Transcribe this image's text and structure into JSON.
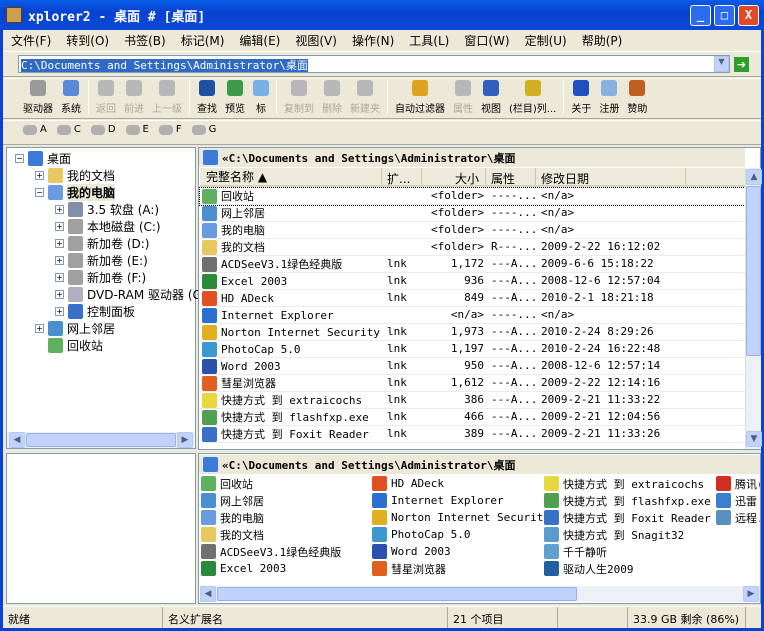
{
  "window": {
    "title": "xplorer2 - 桌面 # [桌面]",
    "min": "_",
    "max": "□",
    "close": "X"
  },
  "menu": [
    "文件(F)",
    "转到(O)",
    "书签(B)",
    "标记(M)",
    "编辑(E)",
    "视图(V)",
    "操作(N)",
    "工具(L)",
    "窗口(W)",
    "定制(U)",
    "帮助(P)"
  ],
  "address": {
    "value": "C:\\Documents and Settings\\Administrator\\桌面",
    "go": "➔"
  },
  "toolbar": [
    {
      "label": "驱动器",
      "icon": "drive-icon",
      "color": "#9a9a9a",
      "enabled": true
    },
    {
      "label": "系统",
      "icon": "computer-icon",
      "color": "#5a8ad8",
      "enabled": true
    },
    {
      "sep": true
    },
    {
      "label": "返回",
      "icon": "back-icon",
      "color": "#b8b8b8",
      "enabled": false
    },
    {
      "label": "前进",
      "icon": "forward-icon",
      "color": "#b8b8b8",
      "enabled": false
    },
    {
      "label": "上一级",
      "icon": "up-folder-icon",
      "color": "#b8b8b8",
      "enabled": false
    },
    {
      "sep": true
    },
    {
      "label": "查找",
      "icon": "find-icon",
      "color": "#2050a0",
      "enabled": true
    },
    {
      "label": "预览",
      "icon": "preview-icon",
      "color": "#3a9a4a",
      "enabled": true
    },
    {
      "label": "标",
      "icon": "folder-icon",
      "color": "#7ab0e8",
      "enabled": true
    },
    {
      "sep": true
    },
    {
      "label": "复制到",
      "icon": "copy-to-icon",
      "color": "#b8b8b8",
      "enabled": false
    },
    {
      "label": "删除",
      "icon": "delete-icon",
      "color": "#b8b8b8",
      "enabled": false
    },
    {
      "label": "新建夹",
      "icon": "new-folder-icon",
      "color": "#b8b8b8",
      "enabled": false
    },
    {
      "sep": true
    },
    {
      "label": "自动过滤器",
      "icon": "filter-icon",
      "color": "#e0a020",
      "enabled": true
    },
    {
      "label": "属性",
      "icon": "properties-icon",
      "color": "#b8b8b8",
      "enabled": false
    },
    {
      "label": "视图",
      "icon": "view-icon",
      "color": "#3060c0",
      "enabled": true
    },
    {
      "label": "(栏目)列...",
      "icon": "columns-icon",
      "color": "#d0b020",
      "enabled": true
    },
    {
      "sep": true
    },
    {
      "label": "关于",
      "icon": "help-icon",
      "color": "#2050c0",
      "enabled": true
    },
    {
      "label": "注册",
      "icon": "register-icon",
      "color": "#8ab0e0",
      "enabled": true
    },
    {
      "label": "赞助",
      "icon": "sponsor-icon",
      "color": "#c06020",
      "enabled": true
    }
  ],
  "drives": [
    "A",
    "C",
    "D",
    "E",
    "F",
    "G"
  ],
  "tree": [
    {
      "label": "桌面",
      "level": 0,
      "pm": "−",
      "color": "#3a7ad8"
    },
    {
      "label": "我的文档",
      "level": 1,
      "pm": "+",
      "color": "#e8c860"
    },
    {
      "label": "我的电脑",
      "level": 1,
      "pm": "−",
      "color": "#6a9ae0",
      "bold": true,
      "selected": true
    },
    {
      "label": "3.5 软盘 (A:)",
      "level": 2,
      "pm": "+",
      "color": "#8090a8"
    },
    {
      "label": "本地磁盘 (C:)",
      "level": 2,
      "pm": "+",
      "color": "#a0a0a0"
    },
    {
      "label": "新加卷 (D:)",
      "level": 2,
      "pm": "+",
      "color": "#a0a0a0"
    },
    {
      "label": "新加卷 (E:)",
      "level": 2,
      "pm": "+",
      "color": "#a0a0a0"
    },
    {
      "label": "新加卷 (F:)",
      "level": 2,
      "pm": "+",
      "color": "#a0a0a0"
    },
    {
      "label": "DVD-RAM 驱动器 (G",
      "level": 2,
      "pm": "+",
      "color": "#b0b0c0"
    },
    {
      "label": "控制面板",
      "level": 2,
      "pm": "+",
      "color": "#3a70c8"
    },
    {
      "label": "网上邻居",
      "level": 1,
      "pm": "+",
      "color": "#4a90d0"
    },
    {
      "label": "回收站",
      "level": 1,
      "pm": "",
      "color": "#60b060"
    }
  ],
  "top_pane": {
    "path": "«C:\\Documents and Settings\\Administrator\\桌面",
    "columns": [
      "完整名称 ▲",
      "扩...",
      "大小",
      "属性",
      "修改日期"
    ],
    "rows": [
      [
        "回收站",
        "",
        "<folder>",
        "----...",
        "<n/a>",
        "#60b060"
      ],
      [
        "网上邻居",
        "",
        "<folder>",
        "----...",
        "<n/a>",
        "#4a90d0"
      ],
      [
        "我的电脑",
        "",
        "<folder>",
        "----...",
        "<n/a>",
        "#6a9ae0"
      ],
      [
        "我的文档",
        "",
        "<folder>",
        "R---...",
        "2009-2-22 16:12:02",
        "#e8c860"
      ],
      [
        "ACDSeeV3.1绿色经典版",
        "lnk",
        "1,172",
        "---A...",
        "2009-6-6 15:18:22",
        "#707070"
      ],
      [
        "Excel 2003",
        "lnk",
        "936",
        "---A...",
        "2008-12-6 12:57:04",
        "#2a8a3a"
      ],
      [
        "HD ADeck",
        "lnk",
        "849",
        "---A...",
        "2010-2-1 18:21:18",
        "#e05020"
      ],
      [
        "Internet Explorer",
        "",
        "<n/a>",
        "----...",
        "<n/a>",
        "#2a70d0"
      ],
      [
        "Norton Internet Security",
        "lnk",
        "1,973",
        "---A...",
        "2010-2-24 8:29:26",
        "#e0b020"
      ],
      [
        "PhotoCap 5.0",
        "lnk",
        "1,197",
        "---A...",
        "2010-2-24 16:22:48",
        "#3a9ad0"
      ],
      [
        "Word 2003",
        "lnk",
        "950",
        "---A...",
        "2008-12-6 12:57:14",
        "#2a50b0"
      ],
      [
        "彗星浏览器",
        "lnk",
        "1,612",
        "---A...",
        "2009-2-22 12:14:16",
        "#e06020"
      ],
      [
        "快捷方式 到 extraicochs",
        "lnk",
        "386",
        "---A...",
        "2009-2-21 11:33:22",
        "#e8d840"
      ],
      [
        "快捷方式 到 flashfxp.exe",
        "lnk",
        "466",
        "---A...",
        "2009-2-21 12:04:56",
        "#50a050"
      ],
      [
        "快捷方式 到 Foxit Reader",
        "lnk",
        "389",
        "---A...",
        "2009-2-21 11:33:26",
        "#3a70c8"
      ]
    ]
  },
  "bottom_pane": {
    "path": "«C:\\Documents and Settings\\Administrator\\桌面",
    "columns": [
      [
        [
          "回收站",
          "#60b060"
        ],
        [
          "网上邻居",
          "#4a90d0"
        ],
        [
          "我的电脑",
          "#6a9ae0"
        ],
        [
          "我的文档",
          "#e8c860"
        ],
        [
          "ACDSeeV3.1绿色经典版",
          "#707070"
        ],
        [
          "Excel 2003",
          "#2a8a3a"
        ]
      ],
      [
        [
          "HD ADeck",
          "#e05020"
        ],
        [
          "Internet Explorer",
          "#2a70d0"
        ],
        [
          "Norton Internet Security",
          "#e0b020"
        ],
        [
          "PhotoCap 5.0",
          "#3a9ad0"
        ],
        [
          "Word 2003",
          "#2a50b0"
        ],
        [
          "彗星浏览器",
          "#e06020"
        ]
      ],
      [
        [
          "快捷方式 到 extraicochs",
          "#e8d840"
        ],
        [
          "快捷方式 到 flashfxp.exe",
          "#50a050"
        ],
        [
          "快捷方式 到 Foxit Reader",
          "#3a70c8"
        ],
        [
          "快捷方式 到 Snagit32",
          "#5a9ad0"
        ],
        [
          "千千静听",
          "#60a0d0"
        ],
        [
          "驱动人生2009",
          "#2060a0"
        ]
      ],
      [
        [
          "腾讯(",
          "#d03020"
        ],
        [
          "迅雷",
          "#3a80d0"
        ],
        [
          "远程...",
          "#5a90c0"
        ]
      ]
    ]
  },
  "status": {
    "ready": "就绪",
    "ext": "名义扩展名",
    "count": "21 个项目",
    "free": "33.9 GB 剩余 (86%)"
  }
}
